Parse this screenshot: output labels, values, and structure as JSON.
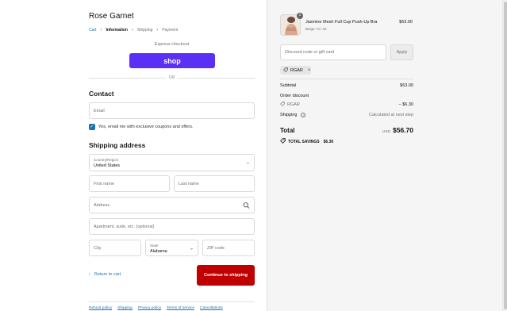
{
  "store": {
    "name": "Rose Garnet"
  },
  "breadcrumbs": [
    {
      "label": "Cart"
    },
    {
      "label": "Information"
    },
    {
      "label": "Shipping"
    },
    {
      "label": "Payment"
    }
  ],
  "express": {
    "label": "Express checkout",
    "shop_button": "shop",
    "or_label": "OR"
  },
  "contact": {
    "heading": "Contact",
    "email_placeholder": "Email",
    "newsletter_label": "Yes, email me with exclusive coupons and offers.",
    "newsletter_checked": true
  },
  "shipping": {
    "heading": "Shipping address",
    "country_label": "Country/Region",
    "country_value": "United States",
    "first_name_placeholder": "First name",
    "last_name_placeholder": "Last name",
    "address_placeholder": "Address",
    "apartment_placeholder": "Apartment, suite, etc. (optional)",
    "city_placeholder": "City",
    "state_label": "State",
    "state_value": "Alabama",
    "zip_placeholder": "ZIP code"
  },
  "actions": {
    "return_label": "Return to cart",
    "continue_label": "Continue to shipping"
  },
  "policies": [
    "Refund policy",
    "Shipping",
    "Privacy policy",
    "Terms of service",
    "Cancellations"
  ],
  "summary": {
    "product": {
      "quantity": "1",
      "name": "Jasmine Mesh Full Cup Push-Up Bra",
      "variant": "Beige / 8 / 32",
      "price": "$63.00"
    },
    "discount_placeholder": "Discount code or gift card",
    "apply_label": "Apply",
    "applied_code": "RGAR",
    "subtotal_label": "Subtotal",
    "subtotal_value": "$63.00",
    "order_discount_label": "Order discount",
    "order_discount_code": "RGAR",
    "order_discount_value": "− $6.30",
    "shipping_label": "Shipping",
    "shipping_value": "Calculated at next step",
    "total_label": "Total",
    "total_currency": "USD",
    "total_value": "$56.70",
    "savings_label": "TOTAL SAVINGS",
    "savings_value": "$6.30"
  },
  "colors": {
    "accent": "#1773b0",
    "shop_pay": "#5a31f4",
    "continue": "#c00000"
  }
}
